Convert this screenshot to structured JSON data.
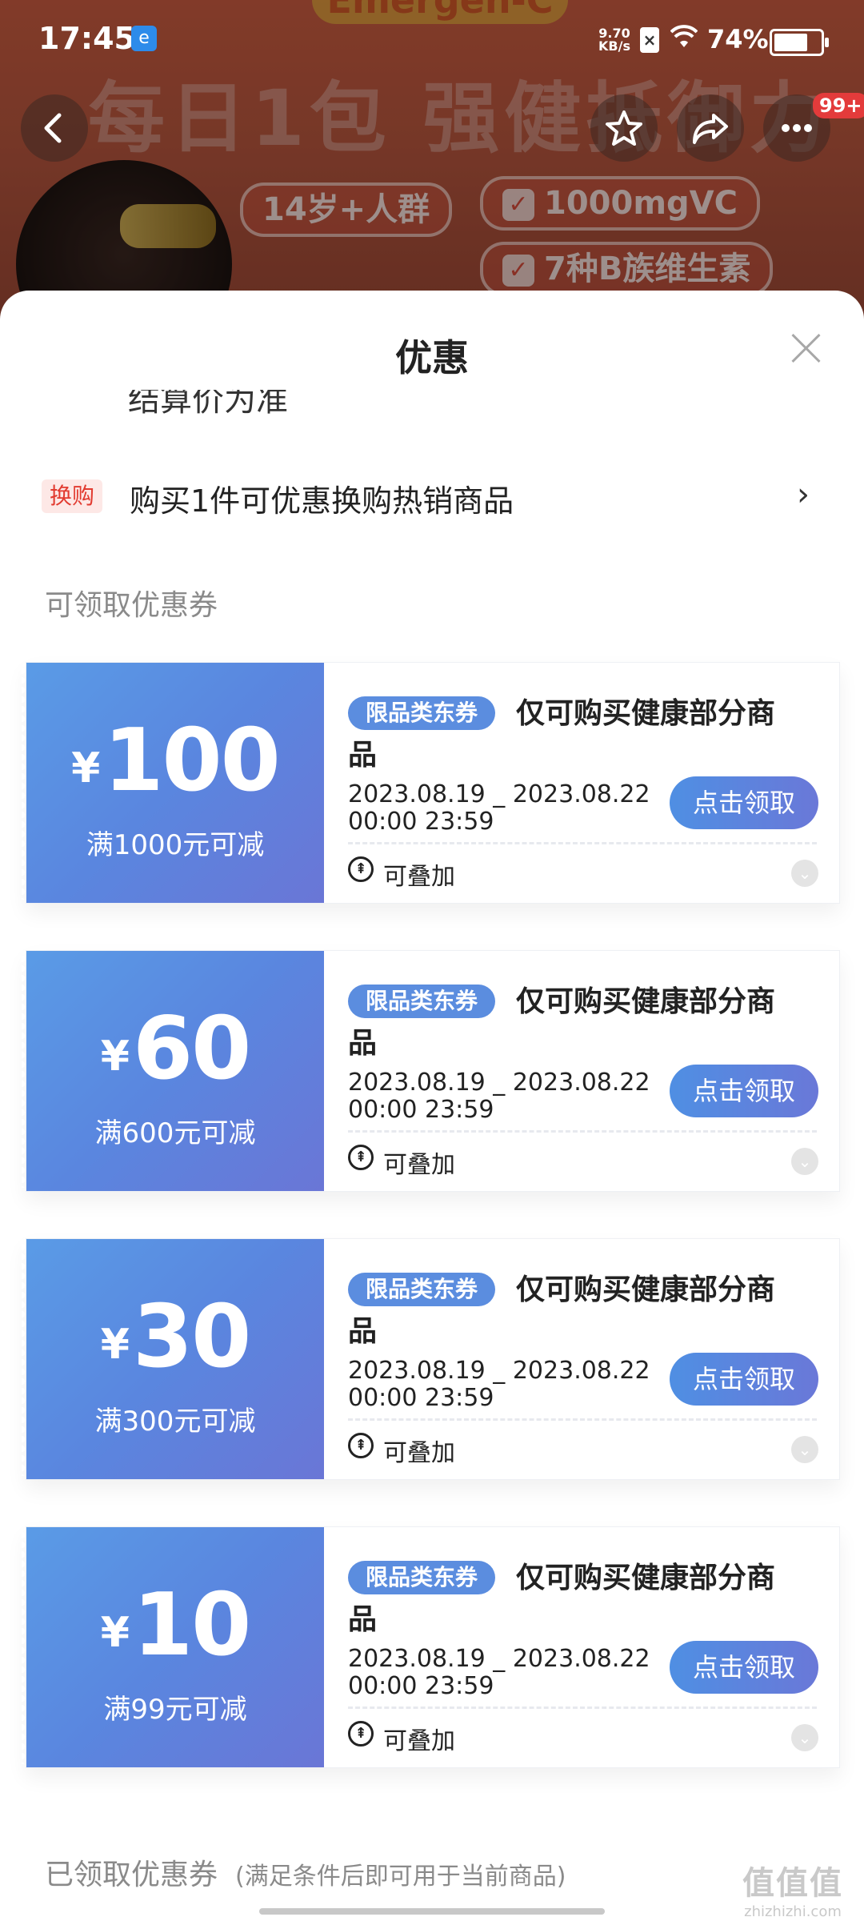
{
  "status_bar": {
    "time": "17:45",
    "net_speed_value": "9.70",
    "net_speed_unit": "KB/s",
    "battery": "74%",
    "battery_level": 0.74
  },
  "product_bg": {
    "brand": "Emergen-C",
    "headline": "每日1包 强健抵御力",
    "pill_age": "14岁+人群",
    "pill_vc": "1000mgVC",
    "pill_b": "7种B族维生素"
  },
  "header": {
    "badge": "99+",
    "icons": {
      "back": "chevron-left-icon",
      "favorite": "star-icon",
      "share": "share-icon",
      "more": "more-icon"
    }
  },
  "sheet": {
    "title": "优惠",
    "clipped_text": "结算价为准",
    "swap": {
      "tag": "换购",
      "text": "购买1件可优惠换购热销商品"
    },
    "available_section": "可领取优惠券",
    "claimed_section": "已领取优惠券",
    "claimed_section_note": "(满足条件后即可用于当前商品)"
  },
  "coupons": [
    {
      "currency": "¥",
      "amount": "100",
      "condition": "满1000元可减",
      "tag": "限品类东券",
      "desc": "仅可购买健康部分商品",
      "date_line1": "2023.08.19 _ 2023.08.22",
      "date_line2": "00:00 23:59",
      "button": "点击领取",
      "stack": "可叠加"
    },
    {
      "currency": "¥",
      "amount": "60",
      "condition": "满600元可减",
      "tag": "限品类东券",
      "desc": "仅可购买健康部分商品",
      "date_line1": "2023.08.19 _ 2023.08.22",
      "date_line2": "00:00 23:59",
      "button": "点击领取",
      "stack": "可叠加"
    },
    {
      "currency": "¥",
      "amount": "30",
      "condition": "满300元可减",
      "tag": "限品类东券",
      "desc": "仅可购买健康部分商品",
      "date_line1": "2023.08.19 _ 2023.08.22",
      "date_line2": "00:00 23:59",
      "button": "点击领取",
      "stack": "可叠加"
    },
    {
      "currency": "¥",
      "amount": "10",
      "condition": "满99元可减",
      "tag": "限品类东券",
      "desc": "仅可购买健康部分商品",
      "date_line1": "2023.08.19 _ 2023.08.22",
      "date_line2": "00:00 23:59",
      "button": "点击领取",
      "stack": "可叠加"
    }
  ],
  "watermark": {
    "big": "值值值",
    "small": "zhizhizhi.com"
  }
}
